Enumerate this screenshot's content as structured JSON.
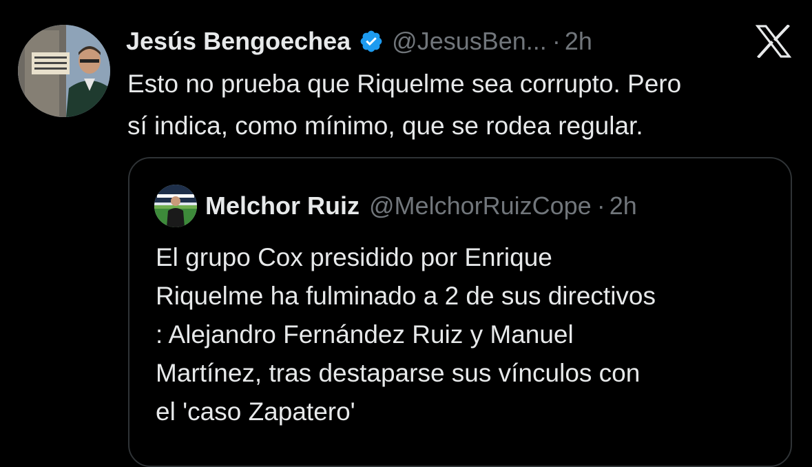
{
  "tweet": {
    "author_name": "Jesús Bengoechea",
    "handle": "@JesusBen...",
    "separator": "·",
    "time": "2h",
    "text_lines": [
      "Esto no prueba que Riquelme sea corrupto. Pero",
      "sí indica, como mínimo, que se rodea regular."
    ]
  },
  "quote": {
    "author_name": "Melchor Ruiz",
    "handle": "@MelchorRuizCope",
    "separator": "·",
    "time": "2h",
    "text_lines": [
      "El grupo Cox presidido por Enrique",
      "Riquelme ha fulminado a 2 de sus directivos",
      ": Alejandro Fernández Ruiz y Manuel",
      "Martínez, tras destaparse sus vínculos con",
      "el 'caso Zapatero'"
    ]
  },
  "icons": {
    "avatar": "profile-photo",
    "verified": "verified-badge-icon",
    "logo": "x-logo-icon",
    "quote_avatar": "profile-photo"
  },
  "colors": {
    "background": "#000000",
    "text_primary": "#e7e9ea",
    "text_secondary": "#71767b",
    "verified_blue": "#1d9bf0",
    "card_border": "#2f3336"
  }
}
